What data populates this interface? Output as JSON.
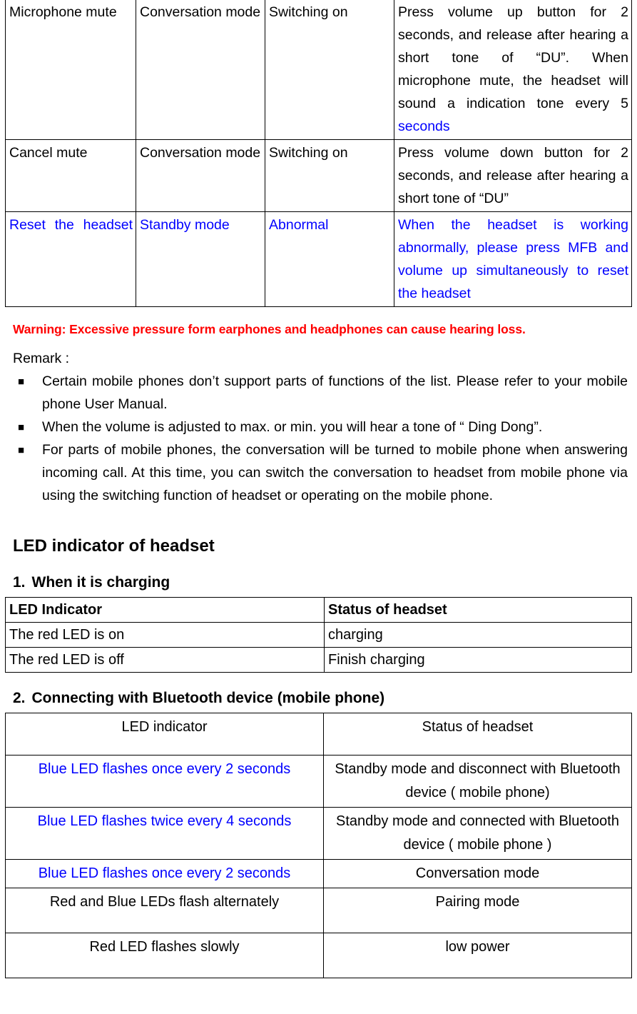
{
  "colors": {
    "blue": "#0000FF",
    "red": "#FF0000",
    "black": "#000000"
  },
  "function_table": {
    "rows": [
      {
        "function": "Microphone mute",
        "mode": "Conversation mode",
        "condition": "Switching on",
        "operation_plain": "Press volume up button for 2 seconds, and release after hearing a short tone of “DU”. When microphone mute, the headset will sound a indication tone every 5 ",
        "operation_blue": "seconds",
        "color": "black"
      },
      {
        "function": "Cancel mute",
        "mode": "Conversation mode",
        "condition": "Switching on",
        "operation_plain": "Press volume down button for 2 seconds, and release after hearing a short tone of “DU”",
        "operation_blue": "",
        "color": "black"
      },
      {
        "function": "Reset the headset",
        "mode": "Standby mode",
        "condition": "Abnormal",
        "operation_plain": "When the headset is working abnormally, please press MFB and volume up simultaneously to reset the headset",
        "operation_blue": "",
        "color": "blue"
      }
    ]
  },
  "warning": {
    "text": "Warning: Excessive pressure form earphones and headphones can cause hearing loss."
  },
  "remark": {
    "label": "Remark :",
    "bullet_glyph": "■",
    "items": [
      "Certain mobile phones don’t support parts of functions of the list. Please refer to your mobile phone User Manual.",
      "When the volume is adjusted to max. or min. you will hear a tone of “ Ding Dong”.",
      "For parts of mobile phones, the conversation will be turned to mobile phone when answering incoming call. At this time, you can switch the conversation to headset from mobile phone via using the switching function of headset or operating on the mobile phone."
    ]
  },
  "led_section": {
    "title": "LED indicator of headset",
    "charging": {
      "number": "1.",
      "heading": "When it is charging",
      "headers": [
        "LED Indicator",
        "Status of headset"
      ],
      "rows": [
        [
          "The red LED is on",
          "charging"
        ],
        [
          "The red LED is off",
          "Finish charging"
        ]
      ]
    },
    "bluetooth": {
      "number": "2.",
      "heading": "Connecting with Bluetooth device (mobile phone)",
      "headers": [
        "LED indicator",
        "Status of headset"
      ],
      "rows": [
        {
          "indicator": "Blue LED flashes once every 2 seconds",
          "status": "Standby mode and disconnect with Bluetooth device ( mobile phone)",
          "indicator_color": "blue"
        },
        {
          "indicator": "Blue LED flashes twice   every 4 seconds",
          "status": "Standby mode and connected with Bluetooth device ( mobile phone )",
          "indicator_color": "blue"
        },
        {
          "indicator": "Blue LED flashes once every 2 seconds",
          "status": "Conversation mode",
          "indicator_color": "blue"
        },
        {
          "indicator": "Red and Blue LEDs flash alternately",
          "status": "Pairing mode",
          "indicator_color": "black"
        },
        {
          "indicator": "Red LED flashes slowly",
          "status": "low power",
          "indicator_color": "black"
        }
      ]
    }
  }
}
